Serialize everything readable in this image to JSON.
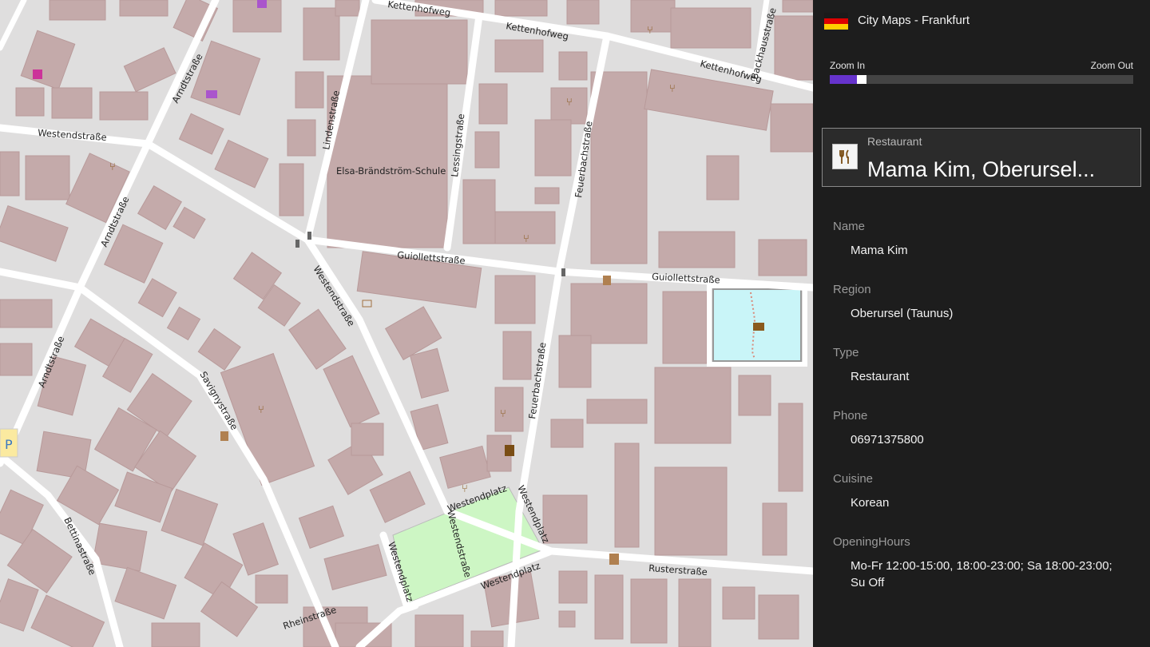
{
  "app": {
    "title": "City Maps - Frankfurt",
    "flag_colors": [
      "#1a1a1a",
      "#dd0000",
      "#ffce00"
    ]
  },
  "zoom": {
    "in_label": "Zoom In",
    "out_label": "Zoom Out",
    "level_fraction": 0.09,
    "accent_color": "#6633cc"
  },
  "poi": {
    "type": "Restaurant",
    "name": "Mama Kim, Oberursel...",
    "icon": "restaurant-icon"
  },
  "details": [
    {
      "label": "Name",
      "value": "Mama Kim"
    },
    {
      "label": "Region",
      "value": "Oberursel (Taunus)"
    },
    {
      "label": "Type",
      "value": "Restaurant"
    },
    {
      "label": "Phone",
      "value": "06971375800"
    },
    {
      "label": "Cuisine",
      "value": "Korean"
    },
    {
      "label": "OpeningHours",
      "value": "Mo-Fr 12:00-15:00, 18:00-23:00; Sa 18:00-23:00; Su Off"
    }
  ],
  "map": {
    "streets": {
      "kettenhofweg_1": "Kettenhofweg",
      "kettenhofweg_2": "Kettenhofweg",
      "kettenhofweg_3": "Kettenhofweg",
      "backhausstrasse": "Backhausstraße",
      "westendstrasse_1": "Westendstraße",
      "westendstrasse_2": "Westendstraße",
      "westendstrasse_3": "Westendstraße",
      "arndtstrasse_1": "Arndtstraße",
      "arndtstrasse_2": "Arndtstraße",
      "arndtstrasse_3": "Arndtstraße",
      "lindenstrasse": "Lindenstraße",
      "lessingstrasse": "Lessingstraße",
      "feuerbachstrasse_1": "Feuerbachstraße",
      "feuerbachstrasse_2": "Feuerbachstraße",
      "guiollettstrasse_1": "Guiollettstraße",
      "guiollettstrasse_2": "Guiollettstraße",
      "savignystrasse": "Savignystraße",
      "westendplatz_1": "Westendplatz",
      "westendplatz_2": "Westendplatz",
      "westendplatz_3": "Westendplatz",
      "westendplatz_4": "Westendplatz",
      "rusterstrasse": "Rusterstraße",
      "rheinstrasse": "Rheinstraße",
      "bettinastrasse": "Bettinastraße"
    },
    "school": "Elsa-Brändström-Schule",
    "parking": "P",
    "colors": {
      "background": "#dfdede",
      "building": "#c4aaaa",
      "road": "#ffffff",
      "park": "#cdf6c4",
      "water": "#c9f5f8"
    }
  }
}
